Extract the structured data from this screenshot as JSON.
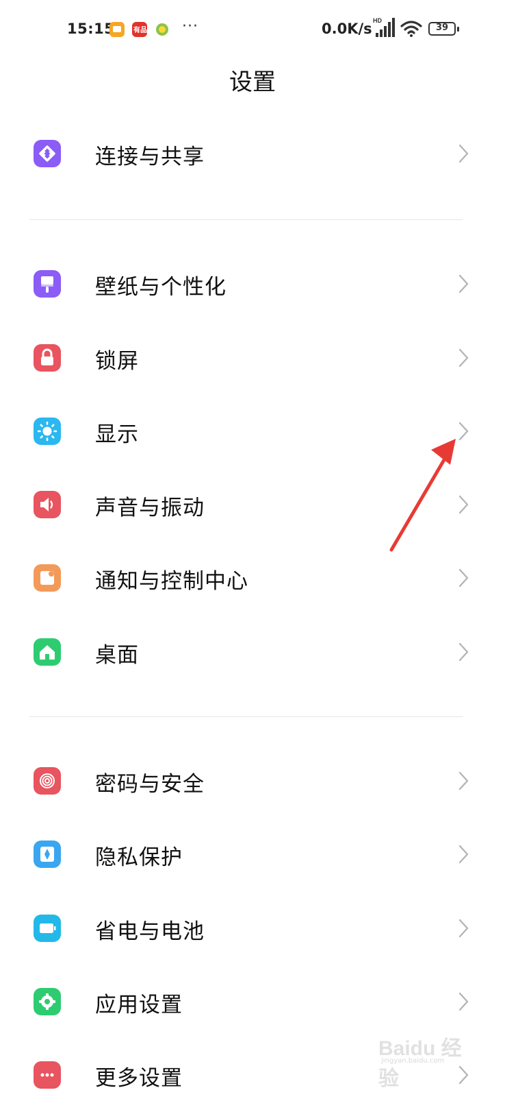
{
  "status_bar": {
    "time": "15:15",
    "more": "···",
    "net_speed": "0.0K/s",
    "signal_label": "HD",
    "battery": "39"
  },
  "title": "设置",
  "groups": [
    [
      {
        "label": "连接与共享",
        "icon": "connection-share-icon",
        "color": "#8b5cf6"
      }
    ],
    [
      {
        "label": "壁纸与个性化",
        "icon": "wallpaper-brush-icon",
        "color": "#8b5cf6"
      },
      {
        "label": "锁屏",
        "icon": "lock-icon",
        "color": "#e8545f"
      },
      {
        "label": "显示",
        "icon": "sun-icon",
        "color": "#2bb7f0"
      },
      {
        "label": "声音与振动",
        "icon": "speaker-icon",
        "color": "#e8545f"
      },
      {
        "label": "通知与控制中心",
        "icon": "notification-icon",
        "color": "#f39a5a"
      },
      {
        "label": "桌面",
        "icon": "home-icon",
        "color": "#2ecc71"
      }
    ],
    [
      {
        "label": "密码与安全",
        "icon": "fingerprint-icon",
        "color": "#e8545f"
      },
      {
        "label": "隐私保护",
        "icon": "privacy-shield-icon",
        "color": "#3aa6f0"
      },
      {
        "label": "省电与电池",
        "icon": "battery-icon",
        "color": "#22b9e8"
      },
      {
        "label": "应用设置",
        "icon": "gear-icon",
        "color": "#2ecc71"
      },
      {
        "label": "更多设置",
        "icon": "more-icon",
        "color": "#e8545f"
      }
    ]
  ],
  "watermark": {
    "text": "Baidu 经验",
    "sub": "jingyan.baidu.com"
  }
}
